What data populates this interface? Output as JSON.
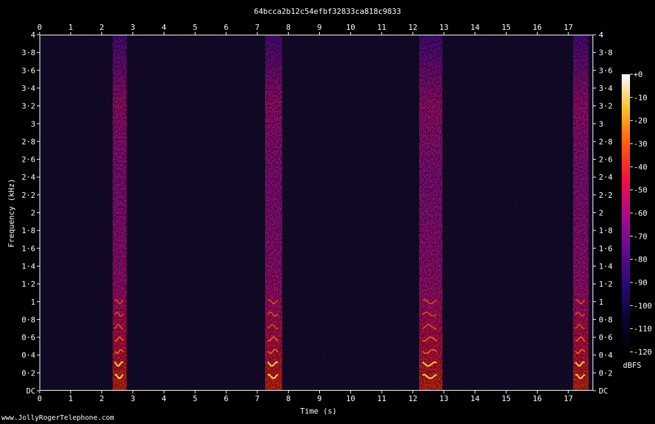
{
  "chart_data": {
    "type": "heatmap",
    "title": "64bcca2b12c54efbf32833ca818c9833",
    "xlabel": "Time (s)",
    "ylabel": "Frequency (kHz)",
    "xlim": [
      0,
      17.8
    ],
    "ylim": [
      0,
      4
    ],
    "x_ticks": [
      "0",
      "1",
      "2",
      "3",
      "4",
      "5",
      "6",
      "7",
      "8",
      "9",
      "10",
      "11",
      "12",
      "13",
      "14",
      "15",
      "16",
      "17"
    ],
    "y_ticks": [
      {
        "value": 0,
        "label": "DC"
      },
      {
        "value": 0.2,
        "label": "0·2"
      },
      {
        "value": 0.4,
        "label": "0·4"
      },
      {
        "value": 0.6,
        "label": "0·6"
      },
      {
        "value": 0.8,
        "label": "0·8"
      },
      {
        "value": 1.0,
        "label": "1"
      },
      {
        "value": 1.2,
        "label": "1·2"
      },
      {
        "value": 1.4,
        "label": "1·4"
      },
      {
        "value": 1.6,
        "label": "1·6"
      },
      {
        "value": 1.8,
        "label": "1·8"
      },
      {
        "value": 2.0,
        "label": "2"
      },
      {
        "value": 2.2,
        "label": "2·2"
      },
      {
        "value": 2.4,
        "label": "2·4"
      },
      {
        "value": 2.6,
        "label": "2·6"
      },
      {
        "value": 2.8,
        "label": "2·8"
      },
      {
        "value": 3.0,
        "label": "3"
      },
      {
        "value": 3.2,
        "label": "3·2"
      },
      {
        "value": 3.4,
        "label": "3·4"
      },
      {
        "value": 3.6,
        "label": "3·6"
      },
      {
        "value": 3.8,
        "label": "3·8"
      },
      {
        "value": 4.0,
        "label": "4"
      }
    ],
    "segments": [
      {
        "start": 2.35,
        "end": 2.8,
        "peak_db": -30
      },
      {
        "start": 7.25,
        "end": 7.8,
        "peak_db": -30
      },
      {
        "start": 12.2,
        "end": 12.95,
        "peak_db": -30
      },
      {
        "start": 17.15,
        "end": 17.65,
        "peak_db": -30
      }
    ],
    "colorbar": {
      "unit": "dBFS",
      "range": [
        -120,
        0
      ],
      "ticks": [
        "+0",
        "-10",
        "-20",
        "-30",
        "-40",
        "-50",
        "-60",
        "-70",
        "-80",
        "-90",
        "-100",
        "-110",
        "-120"
      ]
    },
    "colors": {
      "background": "#000000",
      "noise": "#08041c",
      "low": "#3a0a8c",
      "mid": "#c0108a",
      "high": "#ff2a10",
      "peak": "#ffd040",
      "max": "#ffffff"
    }
  },
  "watermark": "www.JollyRogerTelephone.com"
}
